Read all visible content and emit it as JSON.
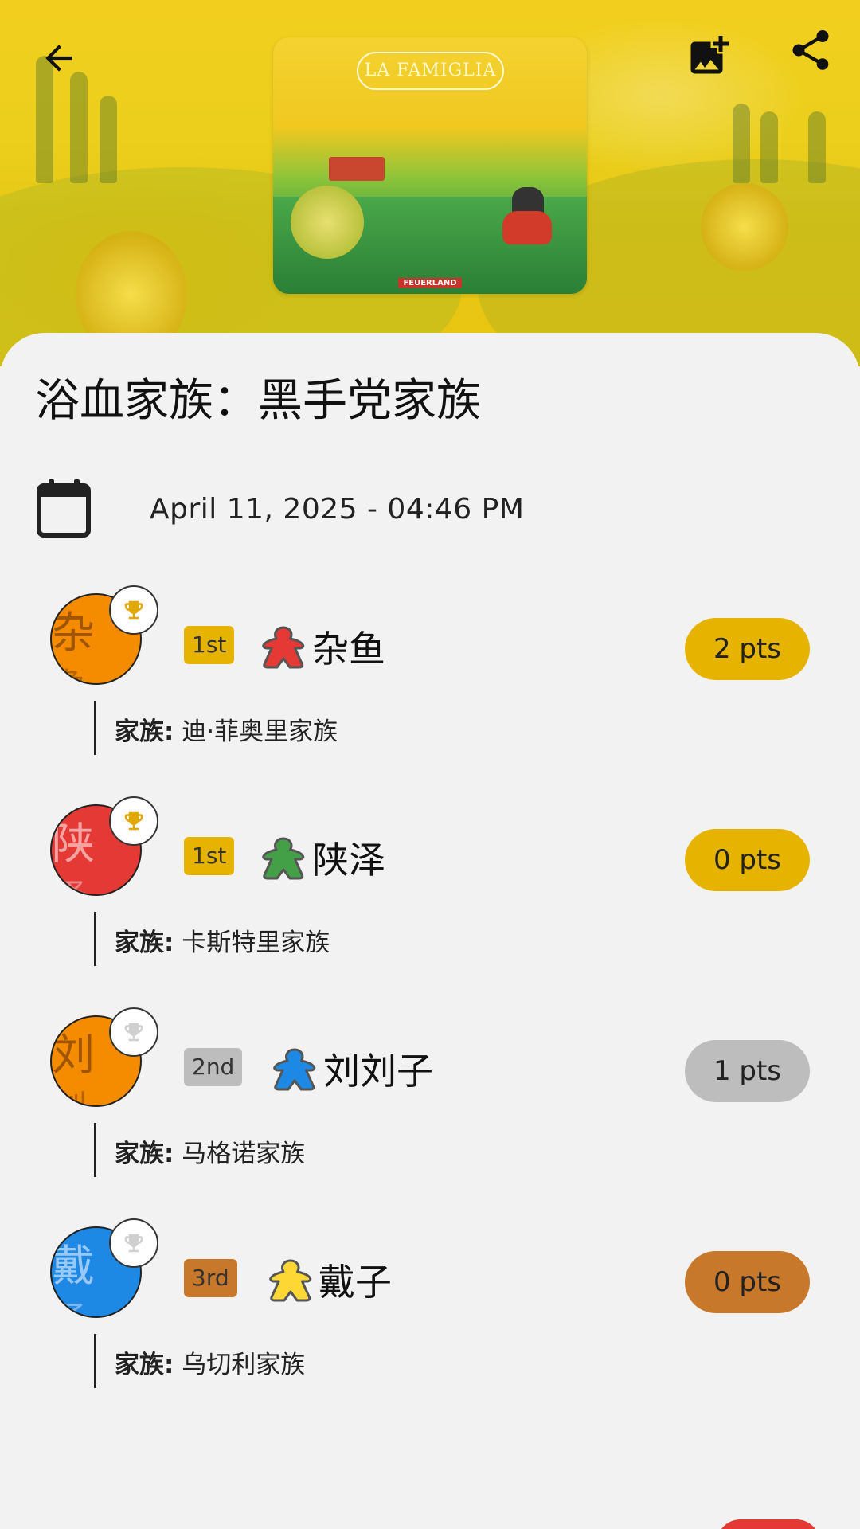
{
  "header": {
    "back_icon": "arrow-back-icon",
    "add_image_icon": "add-photo-icon",
    "share_icon": "share-icon",
    "cover": {
      "title": "LA FAMIGLIA",
      "publisher": "FEUERLAND"
    }
  },
  "game": {
    "title": "浴血家族：黑手党家族",
    "date": "April 11, 2025 - 04:46 PM",
    "date_icon": "calendar-icon"
  },
  "players": [
    {
      "avatar_text": "杂",
      "avatar_text2": "鱼",
      "avatar_color": "#f58c00",
      "trophy_color": "#e0a800",
      "rank": "1st",
      "rank_color": "#e6b400",
      "meeple_color": "#e53935",
      "name": "杂鱼",
      "points": "2 pts",
      "points_color": "#e6b400",
      "family_label": "家族:",
      "family": "迪·菲奥里家族"
    },
    {
      "avatar_text": "陕",
      "avatar_text2": "泽",
      "avatar_color": "#e53935",
      "trophy_color": "#e0a800",
      "rank": "1st",
      "rank_color": "#e6b400",
      "meeple_color": "#43a047",
      "name": "陕泽",
      "points": "0 pts",
      "points_color": "#e6b400",
      "family_label": "家族:",
      "family": "卡斯特里家族"
    },
    {
      "avatar_text": "刘",
      "avatar_text2": "刘",
      "avatar_color": "#f58c00",
      "trophy_color": "#d0d0d0",
      "rank": "2nd",
      "rank_color": "#bdbdbd",
      "meeple_color": "#1e88e5",
      "name": "刘刘子",
      "points": "1 pts",
      "points_color": "#bdbdbd",
      "family_label": "家族:",
      "family": "马格诺家族"
    },
    {
      "avatar_text": "戴",
      "avatar_text2": "子",
      "avatar_color": "#1e88e5",
      "trophy_color": "#d0d0d0",
      "rank": "3rd",
      "rank_color": "#c8782a",
      "meeple_color": "#fdd835",
      "name": "戴子",
      "points": "0 pts",
      "points_color": "#c8782a",
      "family_label": "家族:",
      "family": "乌切利家族"
    }
  ]
}
